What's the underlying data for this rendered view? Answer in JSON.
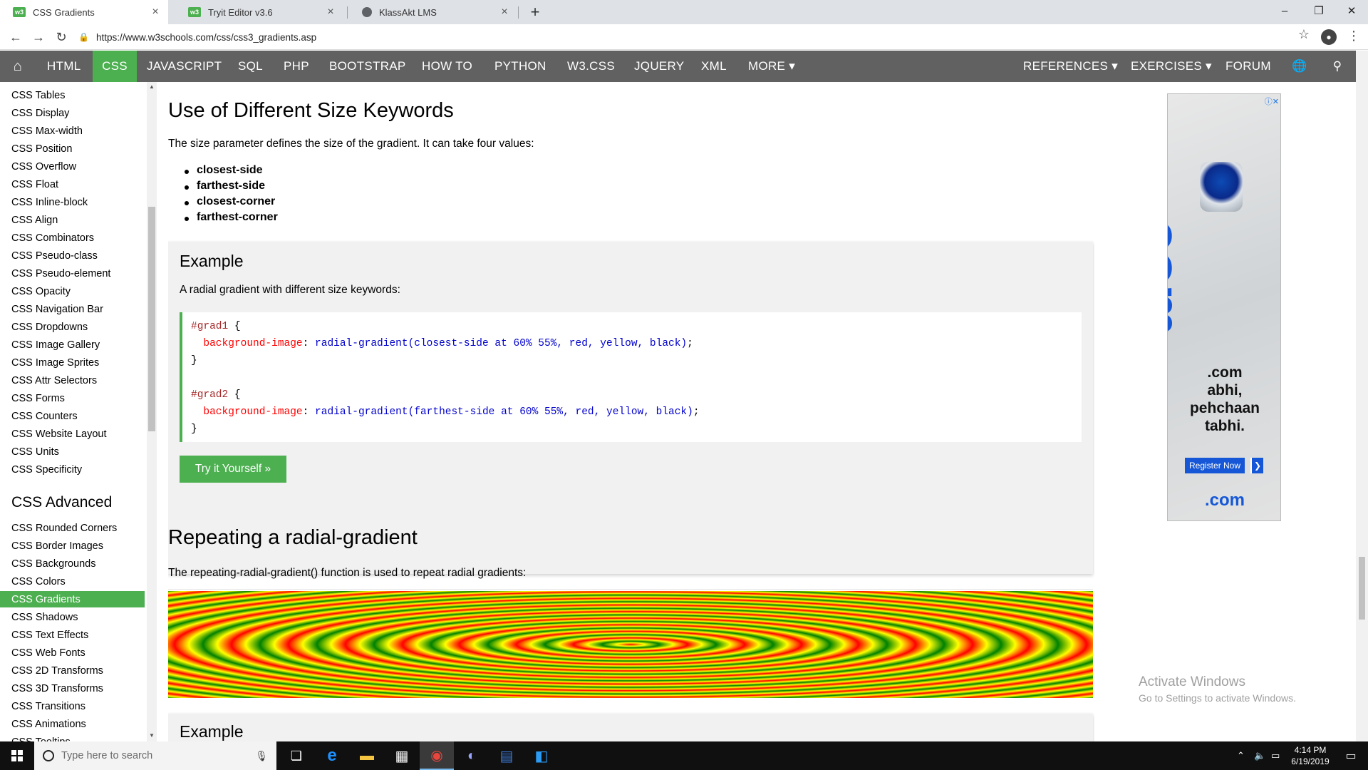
{
  "browser": {
    "tabs": [
      {
        "title": "CSS Gradients",
        "icon": "w3schools-favicon"
      },
      {
        "title": "Tryit Editor v3.6",
        "icon": "w3schools-favicon"
      },
      {
        "title": "KlassAkt LMS",
        "icon": "globe-icon"
      }
    ],
    "url": "https://www.w3schools.com/css/css3_gradients.asp"
  },
  "topnav": {
    "left": [
      "HTML",
      "CSS",
      "JAVASCRIPT",
      "SQL",
      "PHP",
      "BOOTSTRAP",
      "HOW TO",
      "PYTHON",
      "W3.CSS",
      "JQUERY",
      "XML",
      "MORE ▾"
    ],
    "right": [
      "REFERENCES ▾",
      "EXERCISES ▾",
      "FORUM"
    ],
    "active": "CSS"
  },
  "sidebar": {
    "links_top": [
      "CSS Tables",
      "CSS Display",
      "CSS Max-width",
      "CSS Position",
      "CSS Overflow",
      "CSS Float",
      "CSS Inline-block",
      "CSS Align",
      "CSS Combinators",
      "CSS Pseudo-class",
      "CSS Pseudo-element",
      "CSS Opacity",
      "CSS Navigation Bar",
      "CSS Dropdowns",
      "CSS Image Gallery",
      "CSS Image Sprites",
      "CSS Attr Selectors",
      "CSS Forms",
      "CSS Counters",
      "CSS Website Layout",
      "CSS Units",
      "CSS Specificity"
    ],
    "heading": "CSS Advanced",
    "links_advanced": [
      "CSS Rounded Corners",
      "CSS Border Images",
      "CSS Backgrounds",
      "CSS Colors",
      "CSS Gradients",
      "CSS Shadows",
      "CSS Text Effects",
      "CSS Web Fonts",
      "CSS 2D Transforms",
      "CSS 3D Transforms",
      "CSS Transitions",
      "CSS Animations",
      "CSS Tooltips"
    ],
    "active": "CSS Gradients"
  },
  "main": {
    "h_size": "Use of Different Size Keywords",
    "p_size": "The size parameter defines the size of the gradient. It can take four values:",
    "bullets": [
      "closest-side",
      "farthest-side",
      "closest-corner",
      "farthest-corner"
    ],
    "example1": {
      "title": "Example",
      "desc": "A radial gradient with different size keywords:",
      "code": {
        "sel1": "#grad1",
        "prop": "background-image",
        "val1": "radial-gradient(closest-side at 60% 55%, red, yellow, black)",
        "sel2": "#grad2",
        "val2": "radial-gradient(farthest-side at 60% 55%, red, yellow, black)"
      },
      "button": "Try it Yourself »"
    },
    "h_repeat": "Repeating a radial-gradient",
    "p_repeat": "The repeating-radial-gradient() function is used to repeat radial gradients:",
    "example2_title": "Example"
  },
  "ad": {
    "big": "com",
    "tag_lines": [
      ".com",
      "abhi,",
      "pehchaan",
      "tabhi."
    ],
    "button": "Register Now",
    "brand": ".com"
  },
  "watermark": {
    "line1": "Activate Windows",
    "line2": "Go to Settings to activate Windows."
  },
  "taskbar": {
    "search_placeholder": "Type here to search",
    "time": "4:14 PM",
    "date": "6/19/2019"
  },
  "colors": {
    "w3_green": "#4CAF50",
    "nav_gray": "#616161",
    "code_selector": "#a52a2a",
    "code_property": "#ff0000",
    "code_value": "#0000cd"
  }
}
